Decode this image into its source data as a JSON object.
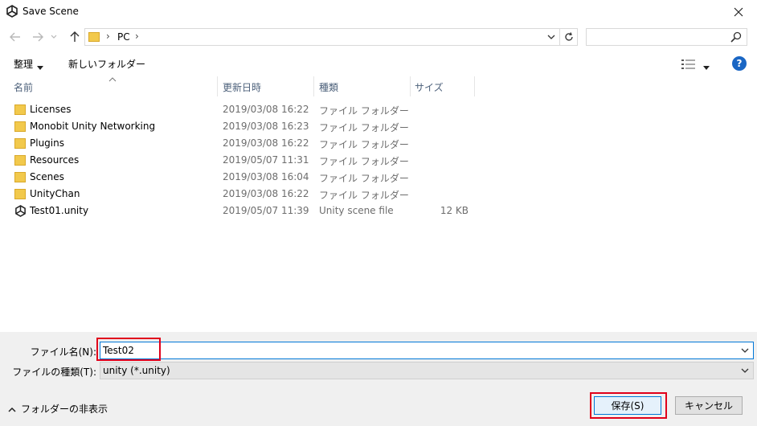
{
  "window": {
    "title": "Save Scene",
    "app_icon": "unity-logo-icon",
    "close_icon": "close-icon"
  },
  "nav": {
    "back_icon": "arrow-left-icon",
    "forward_icon": "arrow-right-icon",
    "recent_icon": "chevron-down-icon",
    "up_icon": "arrow-up-icon",
    "address": {
      "folder_icon": "folder-icon",
      "crumb": "PC",
      "separator": "›"
    },
    "refresh_icon": "refresh-icon",
    "search": {
      "placeholder": "",
      "icon": "search-icon"
    }
  },
  "toolbar": {
    "organize": "整理",
    "new_folder": "新しいフォルダー",
    "view_icon": "details-view-icon",
    "help": "?"
  },
  "columns": {
    "name": "名前",
    "date": "更新日時",
    "type": "種類",
    "size": "サイズ"
  },
  "files": [
    {
      "name": "Licenses",
      "date": "2019/03/08 16:22",
      "type": "ファイル フォルダー",
      "size": "",
      "icon": "folder-icon"
    },
    {
      "name": "Monobit Unity Networking",
      "date": "2019/03/08 16:23",
      "type": "ファイル フォルダー",
      "size": "",
      "icon": "folder-icon"
    },
    {
      "name": "Plugins",
      "date": "2019/03/08 16:22",
      "type": "ファイル フォルダー",
      "size": "",
      "icon": "folder-icon"
    },
    {
      "name": "Resources",
      "date": "2019/05/07 11:31",
      "type": "ファイル フォルダー",
      "size": "",
      "icon": "folder-icon"
    },
    {
      "name": "Scenes",
      "date": "2019/03/08 16:04",
      "type": "ファイル フォルダー",
      "size": "",
      "icon": "folder-icon"
    },
    {
      "name": "UnityChan",
      "date": "2019/03/08 16:22",
      "type": "ファイル フォルダー",
      "size": "",
      "icon": "folder-icon"
    },
    {
      "name": "Test01.unity",
      "date": "2019/05/07 11:39",
      "type": "Unity scene file",
      "size": "12 KB",
      "icon": "unity-file-icon"
    }
  ],
  "form": {
    "filename_label": "ファイル名(N):",
    "filename_value": "Test02",
    "filetype_label": "ファイルの種類(T):",
    "filetype_value": "unity (*.unity)"
  },
  "footer": {
    "hide_folders": "フォルダーの非表示",
    "save": "保存(S)",
    "cancel": "キャンセル"
  },
  "colors": {
    "accent": "#0078d7",
    "highlight_box": "#e0001b",
    "help_badge": "#1a66c4",
    "folder": "#f2c94c"
  }
}
